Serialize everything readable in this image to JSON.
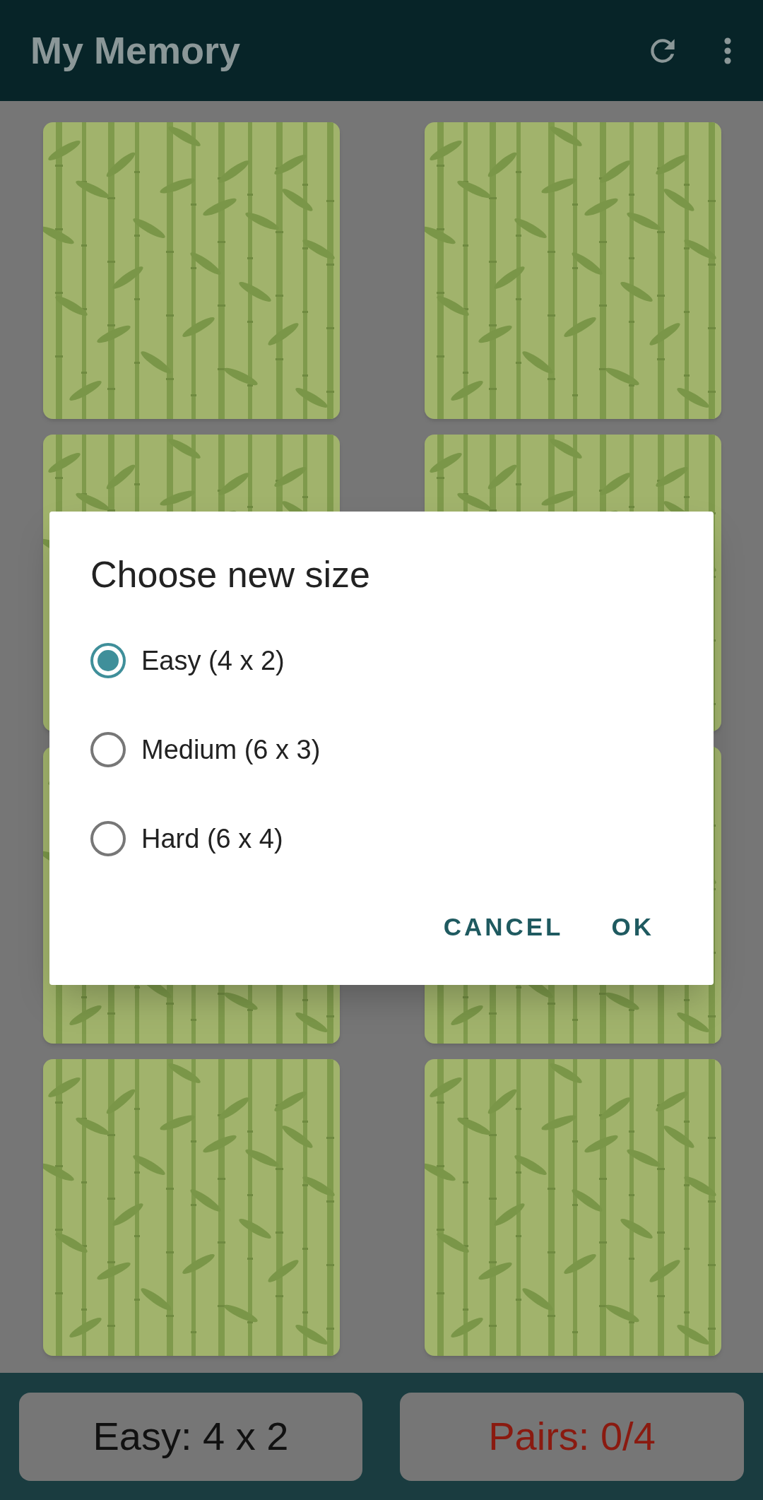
{
  "app_bar": {
    "title": "My Memory"
  },
  "cards": [
    {
      "face_down": true
    },
    {
      "face_down": true
    },
    {
      "face_down": true
    },
    {
      "face_down": true
    },
    {
      "face_down": true
    },
    {
      "face_down": true
    },
    {
      "face_down": true
    },
    {
      "face_down": true
    }
  ],
  "dialog": {
    "title": "Choose new size",
    "options": [
      {
        "label": "Easy (4 x 2)",
        "selected": true
      },
      {
        "label": "Medium (6 x 3)",
        "selected": false
      },
      {
        "label": "Hard (6 x 4)",
        "selected": false
      }
    ],
    "buttons": [
      "CANCEL",
      "OK"
    ]
  },
  "bottom_bar": {
    "size_button": "Easy: 4 x 2",
    "pairs": "Pairs: 0/4"
  }
}
